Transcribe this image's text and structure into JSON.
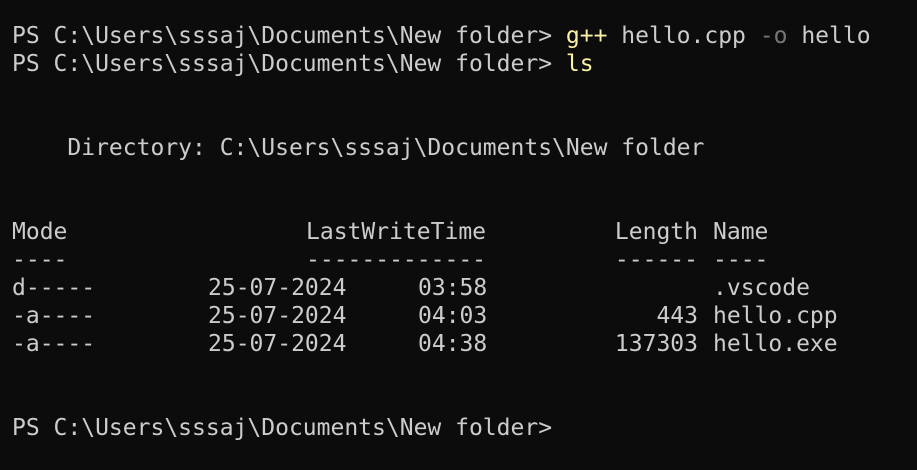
{
  "colors": {
    "background": "#0c0c0c",
    "text": "#cccccc",
    "command": "#f9f1a5",
    "parameter": "#767676"
  },
  "terminal": {
    "prompt": "PS C:\\Users\\sssaj\\Documents\\New folder> ",
    "line1": {
      "command": "g++",
      "args1": " hello.cpp ",
      "flag": "-o",
      "args2": " hello"
    },
    "line2": {
      "command": "ls"
    },
    "directory_line": "    Directory: C:\\Users\\sssaj\\Documents\\New folder",
    "table": {
      "headers": {
        "mode": "Mode",
        "lastwritetime": "LastWriteTime",
        "length": "Length",
        "name": "Name"
      },
      "underlines": {
        "mode": "----",
        "lastwritetime": "-------------",
        "length": "------",
        "name": "----"
      },
      "rows": [
        {
          "mode": "d-----",
          "date": "25-07-2024",
          "time": "03:58",
          "length": "",
          "name": ".vscode"
        },
        {
          "mode": "-a----",
          "date": "25-07-2024",
          "time": "04:03",
          "length": "443",
          "name": "hello.cpp"
        },
        {
          "mode": "-a----",
          "date": "25-07-2024",
          "time": "04:38",
          "length": "137303",
          "name": "hello.exe"
        }
      ]
    },
    "final_prompt": "PS C:\\Users\\sssaj\\Documents\\New folder>"
  }
}
